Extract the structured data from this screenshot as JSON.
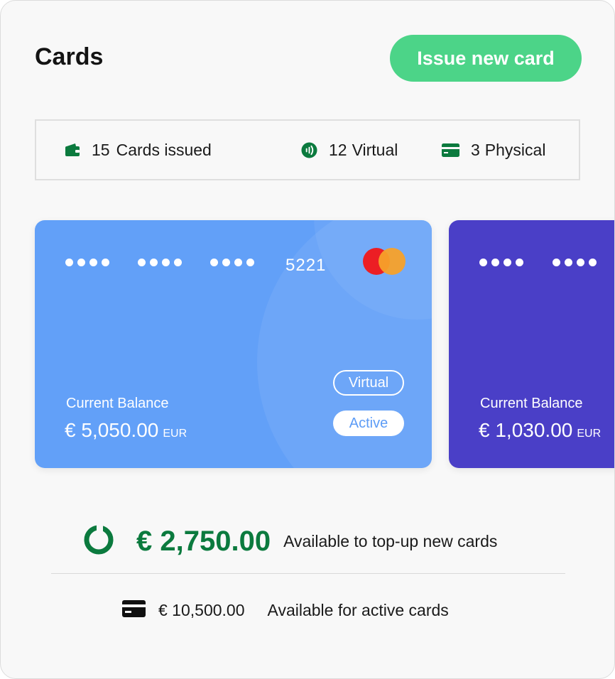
{
  "header": {
    "title": "Cards",
    "issue_button": "Issue new card"
  },
  "stats": [
    {
      "icon": "wallet-icon",
      "count": "15",
      "label": "Cards issued"
    },
    {
      "icon": "contactless-icon",
      "count": "12",
      "label": "Virtual"
    },
    {
      "icon": "card-icon",
      "count": "3",
      "label": "Physical"
    }
  ],
  "cards": [
    {
      "last4": "5221",
      "brand_icon": "mastercard-logo",
      "balance_label": "Current Balance",
      "balance": "€ 5,050.00",
      "currency": "EUR",
      "type_badge": "Virtual",
      "status_badge": "Active",
      "color": "#62a0f8"
    },
    {
      "balance_label": "Current Balance",
      "balance": "€ 1,030.00",
      "currency": "EUR",
      "color": "#4a3fc7"
    }
  ],
  "summary": {
    "topup_amount": "€ 2,750.00",
    "topup_label": "Available to top-up new cards",
    "topup_icon": "progress-ring-icon",
    "active_amount": "€ 10,500.00",
    "active_label": "Available for active cards",
    "active_icon": "credit-card-icon"
  },
  "colors": {
    "accent": "#4cd488",
    "positive": "#0b7a3e",
    "icon_green": "#0b7a3e"
  }
}
